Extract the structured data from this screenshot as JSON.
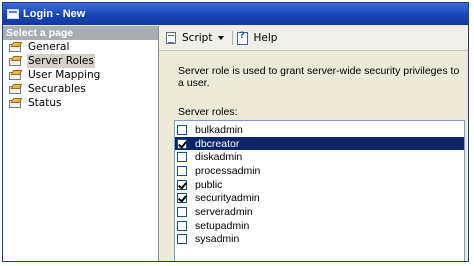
{
  "window": {
    "title": "Login - New"
  },
  "left_panel": {
    "header": "Select a page",
    "pages": [
      {
        "label": "General",
        "selected": false
      },
      {
        "label": "Server Roles",
        "selected": true
      },
      {
        "label": "User Mapping",
        "selected": false
      },
      {
        "label": "Securables",
        "selected": false
      },
      {
        "label": "Status",
        "selected": false
      }
    ]
  },
  "toolbar": {
    "script_label": "Script",
    "help_label": "Help"
  },
  "main": {
    "description": "Server role is used to grant server-wide security privileges to a user.",
    "roles_label": "Server roles:",
    "roles": [
      {
        "name": "bulkadmin",
        "checked": false,
        "selected": false
      },
      {
        "name": "dbcreator",
        "checked": true,
        "selected": true
      },
      {
        "name": "diskadmin",
        "checked": false,
        "selected": false
      },
      {
        "name": "processadmin",
        "checked": false,
        "selected": false
      },
      {
        "name": "public",
        "checked": true,
        "selected": false
      },
      {
        "name": "securityadmin",
        "checked": true,
        "selected": false
      },
      {
        "name": "serveradmin",
        "checked": false,
        "selected": false
      },
      {
        "name": "setupadmin",
        "checked": false,
        "selected": false
      },
      {
        "name": "sysadmin",
        "checked": false,
        "selected": false
      }
    ]
  },
  "colors": {
    "titlebar": "#1845b6",
    "selection": "#0a246a",
    "panel_header": "#a8acb3"
  }
}
